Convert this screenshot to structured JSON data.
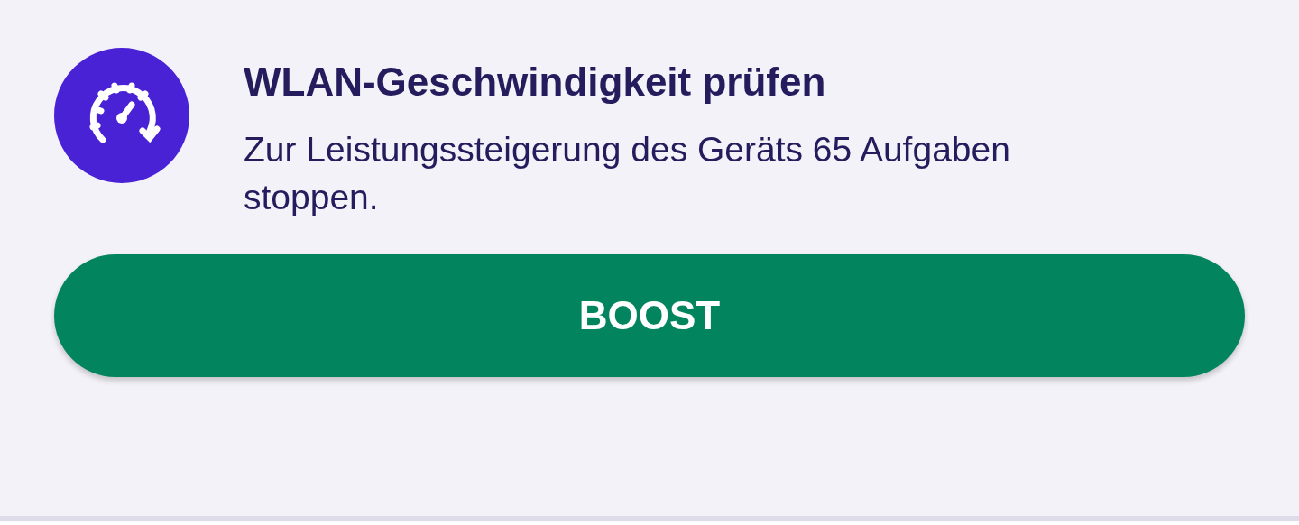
{
  "card": {
    "title": "WLAN-Geschwindigkeit prüfen",
    "description": "Zur Leistungssteigerung des Geräts 65 Aufgaben stoppen.",
    "button": "BOOST"
  }
}
